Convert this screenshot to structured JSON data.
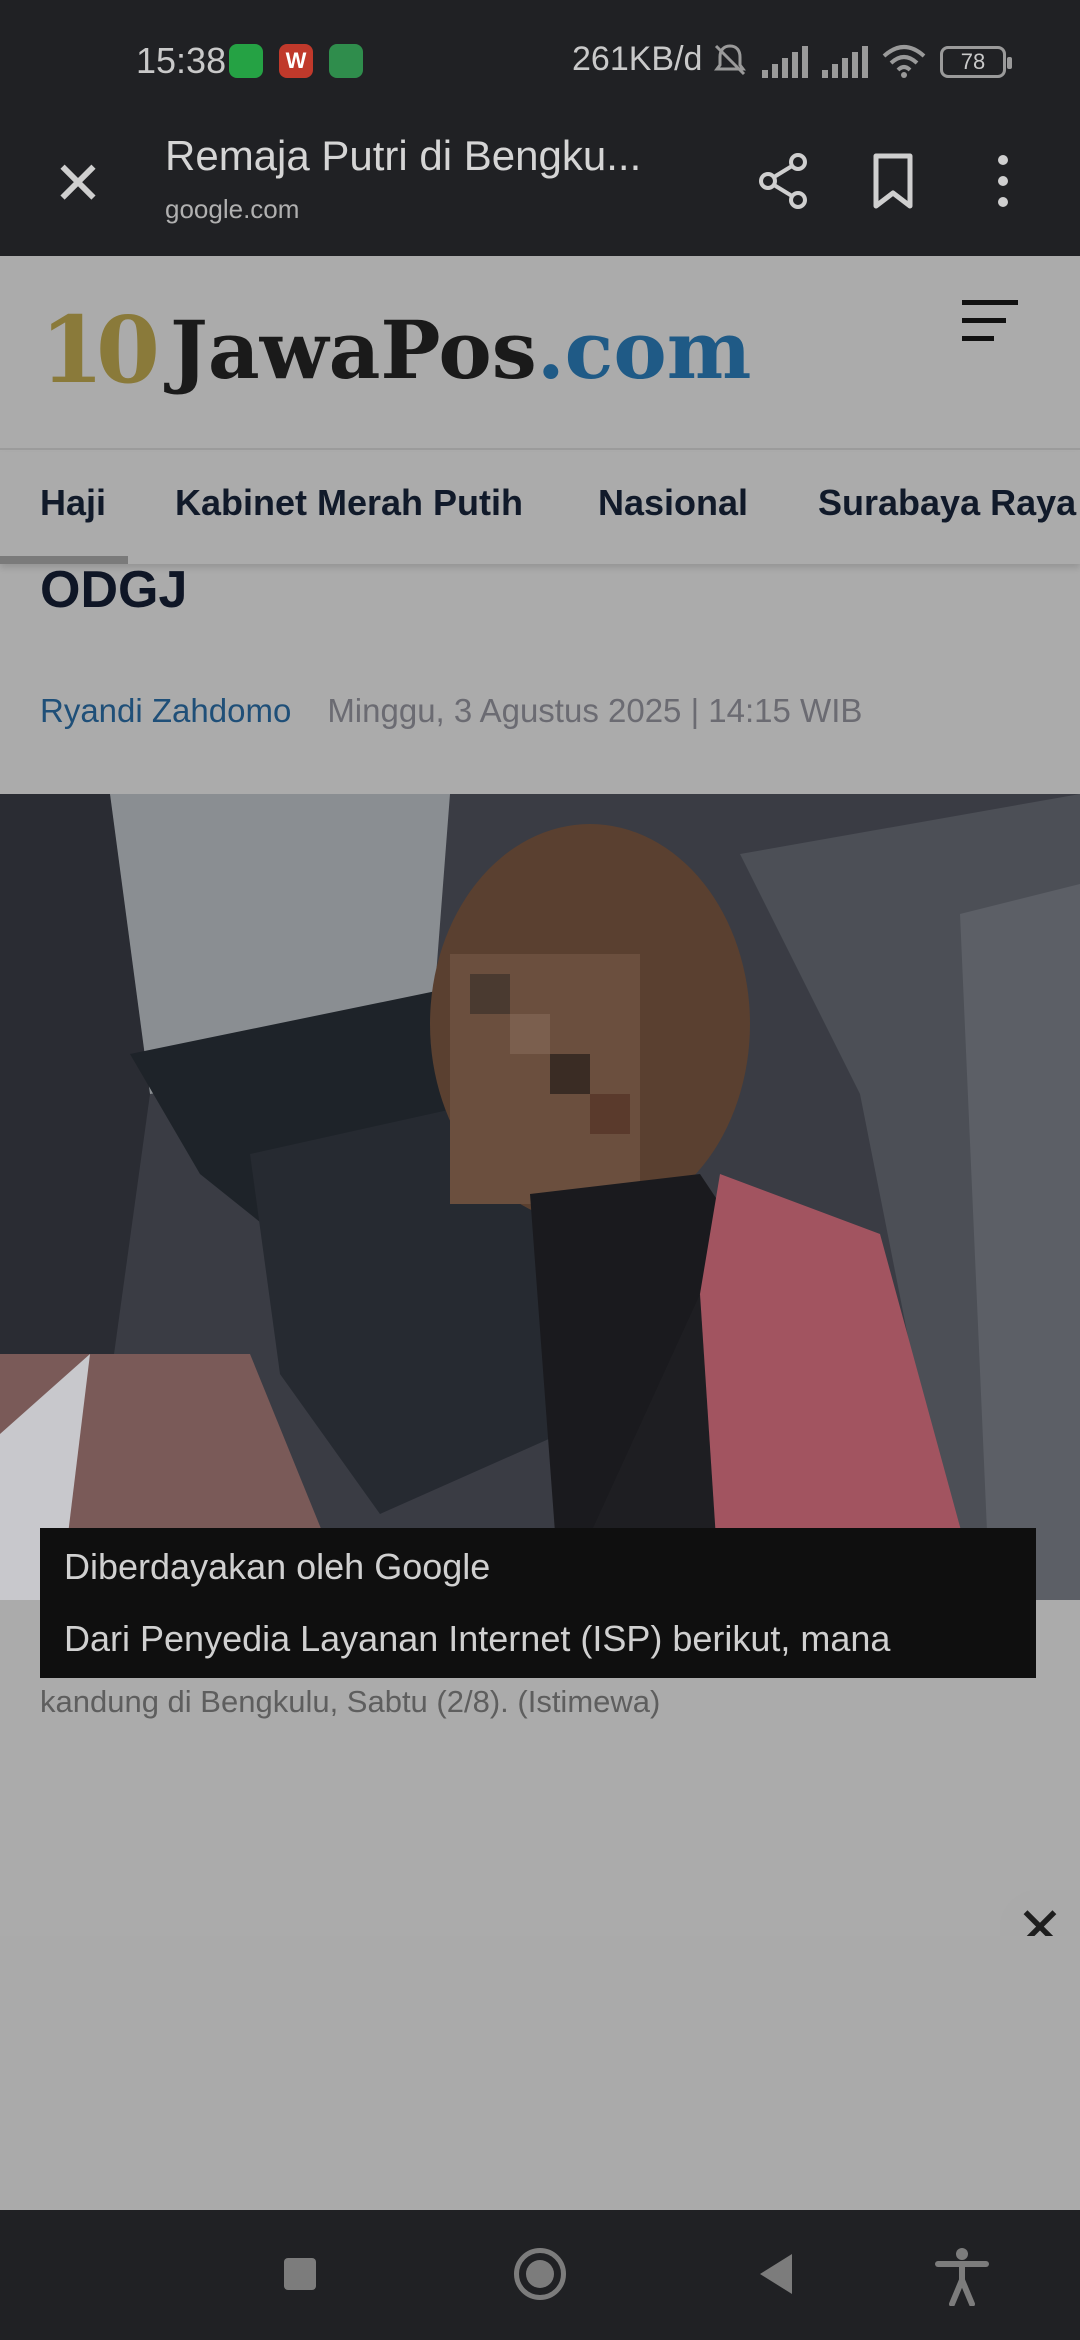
{
  "status_bar": {
    "time": "15:38",
    "network_speed": "261KB/d",
    "battery": "78",
    "icons": [
      "whatsapp-icon",
      "wps-icon",
      "puzzle-icon",
      "mute-icon",
      "signal-icon",
      "signal-icon",
      "wifi-icon",
      "battery-icon"
    ]
  },
  "toolbar": {
    "close_icon": "close-icon",
    "title": "Remaja Putri di Bengku...",
    "url": "google.com",
    "actions": [
      "share-icon",
      "bookmark-icon",
      "more-icon"
    ]
  },
  "site": {
    "logo_10": "10",
    "logo_brand": "JawaPos",
    "logo_tld": ".com",
    "menu_icon": "hamburger-icon"
  },
  "categories": [
    "Haji",
    "Kabinet Merah Putih",
    "Nasional",
    "Surabaya Raya"
  ],
  "article": {
    "headline_tail": "ODGJ",
    "author": "Ryandi Zahdomo",
    "datetime": "Minggu, 3 Agustus 2025 | 14:15 WIB",
    "caption": "Tangkapan layar detik-detik pelaku pembunuhan Ibu oleh anak kandung di Bengkulu, Sabtu (2/8). (Istimewa)"
  },
  "ad": {
    "powered_by": "Diberdayakan oleh Google",
    "text": "Dari Penyedia Layanan Internet (ISP) berikut, mana",
    "close_icon": "close-icon"
  },
  "colors": {
    "system_bar": "#202124",
    "author_link": "#1f4f78",
    "logo_gold": "#8a7a3a",
    "logo_blue": "#1f5a86"
  }
}
